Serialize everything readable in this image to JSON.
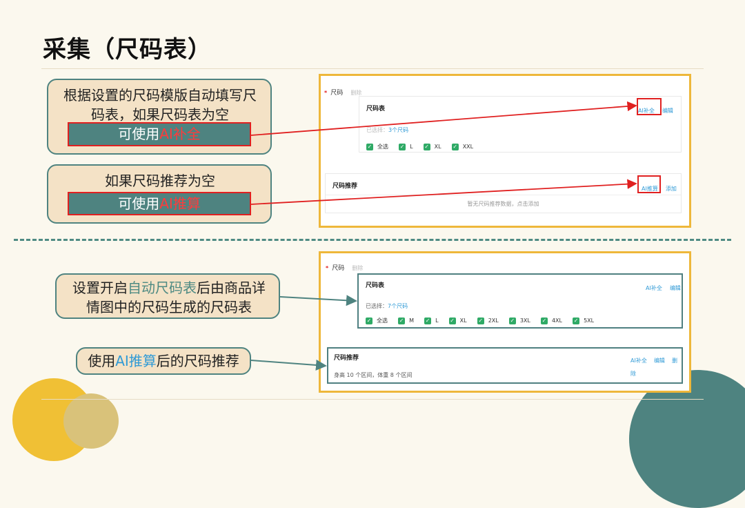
{
  "slide": {
    "title": "采集（尺码表）",
    "colors": {
      "teal": "#4e8380",
      "accent_red": "#e02020",
      "panel_border": "#eeb73a",
      "background": "#fbf8ee"
    }
  },
  "callouts": {
    "c1": {
      "text": "根据设置的尺码模版自动填写尺码表，如果尺码表为空",
      "hl_prefix": "可使用",
      "hl_red": "AI补全"
    },
    "c2": {
      "text": "如果尺码推荐为空",
      "hl_prefix": "可使用",
      "hl_red": "AI推算"
    },
    "c3": {
      "pre": "设置开启",
      "teal": "自动尺码表",
      "post": "后由商品详情图中的尺码生成的尺码表"
    },
    "c4": {
      "pre": "使用",
      "blue": "AI推算",
      "post": "后的尺码推荐"
    }
  },
  "top_panel": {
    "section_label": "尺码",
    "section_delete": "删除",
    "size_table": {
      "title": "尺码表",
      "ai_fill": "AI补全",
      "edit": "编辑",
      "selected_prefix": "已选择：",
      "selected_count": "3个尺码",
      "options": [
        "全选",
        "L",
        "XL",
        "XXL"
      ]
    },
    "size_rec": {
      "title": "尺码推荐",
      "ai_calc": "AI推算",
      "add": "添加",
      "empty_text": "暂无尺码推荐数据，点击添加"
    }
  },
  "bottom_panel": {
    "section_label": "尺码",
    "section_delete": "删除",
    "size_table": {
      "title": "尺码表",
      "ai_fill": "AI补全",
      "edit": "编辑",
      "selected_prefix": "已选择：",
      "selected_count": "7个尺码",
      "options": [
        "全选",
        "M",
        "L",
        "XL",
        "2XL",
        "3XL",
        "4XL",
        "5XL"
      ]
    },
    "size_rec": {
      "title": "尺码推荐",
      "ai_fill": "AI补全",
      "edit": "编辑",
      "delete": "删除",
      "summary": "身高 10 个区间，体重 8 个区间"
    }
  }
}
